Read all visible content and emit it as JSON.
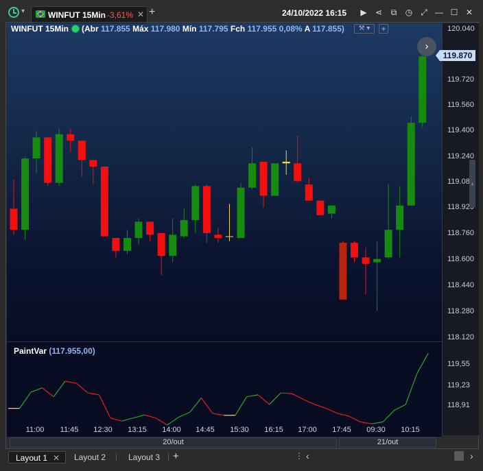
{
  "header": {
    "tab_title": "WINFUT 15Min",
    "tab_change": "-3,61%",
    "tab_close": "✕",
    "add_tab": "+",
    "datetime": "24/10/2022 16:15",
    "icons": [
      "play-icon",
      "share-icon",
      "window-icon",
      "clock-icon",
      "expand-icon",
      "minimize-icon",
      "maximize-icon",
      "close-icon"
    ],
    "icon_glyphs": [
      "▶",
      "⋖",
      "⧉",
      "◷",
      "⤢",
      "—",
      "☐",
      "✕"
    ]
  },
  "legend": {
    "symbol": "WINFUT 15Min",
    "abr_label": "(Abr",
    "abr_value": "117.855",
    "max_label": "Máx",
    "max_value": "117.980",
    "min_label": "Mín",
    "min_value": "117.795",
    "fch_label": "Fch",
    "fch_value": "117.955",
    "pct_value": "0,08%",
    "a_label": "A",
    "a_value": "117.855)",
    "tools": "⚒ ▾",
    "add": "+"
  },
  "price_axis": {
    "ticks": [
      "120.040",
      "119.720",
      "119.560",
      "119.400",
      "119.240",
      "119.08",
      "118.920",
      "118.760",
      "118.600",
      "118.440",
      "118.280",
      "118.120"
    ],
    "last_price": "119.870"
  },
  "indicator": {
    "name": "PaintVar",
    "value": "(117.955,00)",
    "ticks": [
      "119,55",
      "119,23",
      "118,91"
    ]
  },
  "time_axis": {
    "ticks": [
      "11:00",
      "11:45",
      "12:30",
      "13:15",
      "14:00",
      "14:45",
      "15:30",
      "16:15",
      "17:00",
      "17:45",
      "09:30",
      "10:15"
    ],
    "days": [
      "20/out",
      "21/out"
    ]
  },
  "chart_data": {
    "type": "candlestick",
    "series": [
      {
        "o": 118.93,
        "h": 119.11,
        "l": 118.77,
        "c": 118.8
      },
      {
        "o": 118.8,
        "h": 119.25,
        "l": 118.74,
        "c": 119.24
      },
      {
        "o": 119.24,
        "h": 119.41,
        "l": 119.15,
        "c": 119.37
      },
      {
        "o": 119.37,
        "h": 119.37,
        "l": 119.07,
        "c": 119.09
      },
      {
        "o": 119.09,
        "h": 119.42,
        "l": 119.07,
        "c": 119.39
      },
      {
        "o": 119.39,
        "h": 119.42,
        "l": 119.28,
        "c": 119.35
      },
      {
        "o": 119.35,
        "h": 119.35,
        "l": 119.13,
        "c": 119.23
      },
      {
        "o": 119.23,
        "h": 119.23,
        "l": 119.08,
        "c": 119.19
      },
      {
        "o": 119.19,
        "h": 119.19,
        "l": 118.76,
        "c": 118.76
      },
      {
        "o": 118.75,
        "h": 118.75,
        "l": 118.63,
        "c": 118.67
      },
      {
        "o": 118.67,
        "h": 118.8,
        "l": 118.65,
        "c": 118.75
      },
      {
        "o": 118.75,
        "h": 118.87,
        "l": 118.71,
        "c": 118.85
      },
      {
        "o": 118.85,
        "h": 118.85,
        "l": 118.73,
        "c": 118.77
      },
      {
        "o": 118.78,
        "h": 118.78,
        "l": 118.52,
        "c": 118.64
      },
      {
        "o": 118.64,
        "h": 118.87,
        "l": 118.6,
        "c": 118.77
      },
      {
        "o": 118.76,
        "h": 118.93,
        "l": 118.75,
        "c": 118.86
      },
      {
        "o": 118.86,
        "h": 119.08,
        "l": 118.78,
        "c": 119.07
      },
      {
        "o": 119.07,
        "h": 119.08,
        "l": 118.72,
        "c": 118.78
      },
      {
        "o": 118.77,
        "h": 118.81,
        "l": 118.72,
        "c": 118.75
      },
      {
        "o": 118.76,
        "h": 118.96,
        "l": 118.73,
        "c": 118.76
      },
      {
        "o": 118.75,
        "h": 119.09,
        "l": 118.75,
        "c": 119.06
      },
      {
        "o": 119.06,
        "h": 119.31,
        "l": 119.05,
        "c": 119.21
      },
      {
        "o": 119.22,
        "h": 119.22,
        "l": 118.94,
        "c": 119.01
      },
      {
        "o": 119.01,
        "h": 119.21,
        "l": 119.01,
        "c": 119.21
      },
      {
        "o": 119.22,
        "h": 119.29,
        "l": 119.14,
        "c": 119.21
      },
      {
        "o": 119.21,
        "h": 119.38,
        "l": 119.09,
        "c": 119.1
      },
      {
        "o": 119.08,
        "h": 119.12,
        "l": 118.98,
        "c": 118.98
      },
      {
        "o": 118.98,
        "h": 118.98,
        "l": 118.89,
        "c": 118.89
      },
      {
        "o": 118.9,
        "h": 118.95,
        "l": 118.87,
        "c": 118.95
      },
      {
        "o": 118.72,
        "h": 118.73,
        "l": 118.37,
        "c": 118.37
      },
      {
        "o": 118.72,
        "h": 118.73,
        "l": 118.6,
        "c": 118.63
      },
      {
        "o": 118.63,
        "h": 118.69,
        "l": 118.4,
        "c": 118.59
      },
      {
        "o": 118.6,
        "h": 118.73,
        "l": 118.3,
        "c": 118.62
      },
      {
        "o": 118.63,
        "h": 119.08,
        "l": 118.62,
        "c": 118.8
      },
      {
        "o": 118.8,
        "h": 119.07,
        "l": 118.63,
        "c": 118.95
      },
      {
        "o": 118.95,
        "h": 119.5,
        "l": 118.95,
        "c": 119.46
      },
      {
        "o": 119.46,
        "h": 119.92,
        "l": 119.43,
        "c": 119.87
      }
    ],
    "indicator_series": [
      118.95,
      118.95,
      119.37,
      119.48,
      119.25,
      119.65,
      119.6,
      119.35,
      119.3,
      118.7,
      118.62,
      118.7,
      118.78,
      118.7,
      118.52,
      118.72,
      118.85,
      119.22,
      118.82,
      118.77,
      118.77,
      119.25,
      119.3,
      119.05,
      119.35,
      119.33,
      119.18,
      119.05,
      118.95,
      118.82,
      118.75,
      118.6,
      118.55,
      118.6,
      118.9,
      119.05,
      119.85,
      120.38
    ],
    "ylim": [
      118.08,
      120.1
    ],
    "up_color": "#178a10",
    "down_color": "#f20f0f",
    "line_up_color": "#22aa22",
    "line_down_color": "#ee1a1a",
    "doji_color": "#f5d84a",
    "grid": false
  },
  "layouts": {
    "tabs": [
      "Layout 1",
      "Layout 2",
      "Layout 3"
    ],
    "close": "✕",
    "add": "+",
    "more": "⋮",
    "left": "‹",
    "right": "›"
  }
}
